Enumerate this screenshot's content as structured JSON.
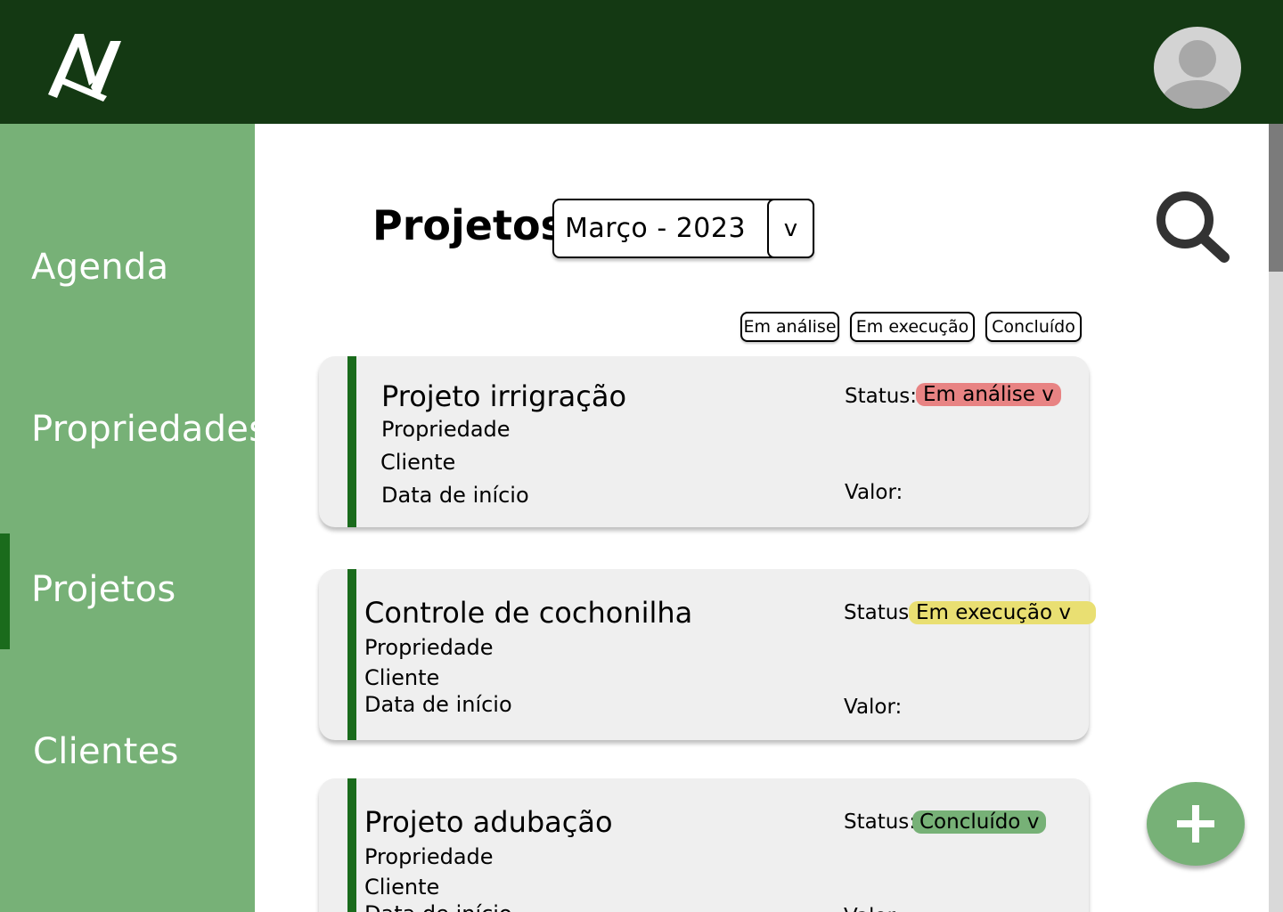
{
  "header": {
    "logo_icon": "logo-icon",
    "avatar_icon": "user-avatar-icon"
  },
  "sidebar": {
    "items": [
      {
        "label": "Agenda",
        "active": false
      },
      {
        "label": "Propriedades",
        "active": false
      },
      {
        "label": "Projetos",
        "active": true
      },
      {
        "label": "Clientes",
        "active": false
      }
    ]
  },
  "main": {
    "title": "Projetos",
    "month_select": {
      "value": "Março - 2023",
      "arrow": "v"
    },
    "search_icon": "search-icon",
    "filters": [
      "Em análise",
      "Em execução",
      "Concluído"
    ],
    "projects": [
      {
        "title": "Projeto irrigração",
        "property_label": "Propriedade",
        "client_label": "Cliente",
        "start_label": "Data de início",
        "status_label": "Status:",
        "status": "Em análise v",
        "status_color": "#e88383",
        "value_label": "Valor:"
      },
      {
        "title": "Controle de cochonilha",
        "property_label": "Propriedade",
        "client_label": "Cliente",
        "start_label": "Data de início",
        "status_label": "Status:",
        "status": "Em execução v",
        "status_color": "#e9df72",
        "value_label": "Valor:"
      },
      {
        "title": "Projeto adubação",
        "property_label": "Propriedade",
        "client_label": "Cliente",
        "start_label": "Data de início",
        "status_label": "Status:",
        "status": "Concluído v",
        "status_color": "#77b177",
        "value_label": "Valor:"
      }
    ],
    "fab_icon": "plus-icon"
  },
  "colors": {
    "header": "#143913",
    "sidebar": "#77b177",
    "accent": "#1a6b1c",
    "card": "#efefef"
  }
}
